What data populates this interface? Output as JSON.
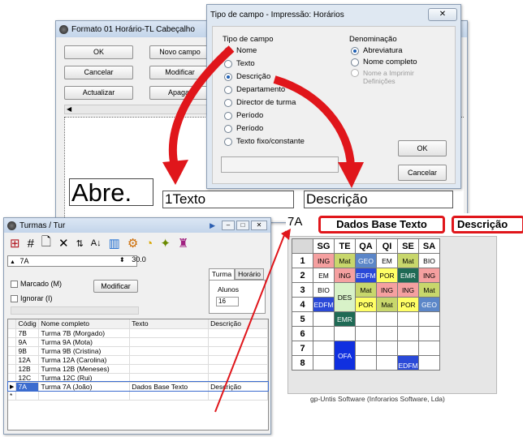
{
  "formato_window": {
    "title": "Formato 01  Horário-TL  Cabeçalho",
    "buttons": {
      "ok": "OK",
      "novo_campo": "Novo campo",
      "cancelar": "Cancelar",
      "modificar": "Modificar",
      "actualizar": "Actualizar",
      "apagar": "Apagar"
    },
    "canvas_fields": {
      "abreviatura": "Abre.",
      "texto": "1Texto",
      "descricao": "Descrição"
    }
  },
  "tipo_dialog": {
    "title": "Tipo de campo - Impressão: Horários",
    "tipo_group_label": "Tipo de campo",
    "tipo_options": [
      "Nome",
      "Texto",
      "Descrição",
      "Departamento",
      "Director de turma",
      "Período",
      "Período",
      "Texto fixo/constante"
    ],
    "denominacao_group_label": "Denominação",
    "denominacao_options": [
      "Abreviatura",
      "Nome completo",
      "Nome a Imprimir Definições"
    ],
    "ok_label": "OK",
    "cancel_label": "Cancelar"
  },
  "turmas_window": {
    "title": "Turmas / Tur",
    "current_class": "7A",
    "number_value": "30.0",
    "tabs": [
      "Turma",
      "Horário"
    ],
    "alunos_label": "Alunos",
    "alunos_value": "16",
    "marcado_label": "Marcado (M)",
    "ignorar_label": "Ignorar (I)",
    "modificar_label": "Modificar",
    "columns": [
      "Códig",
      "Nome completo",
      "Texto",
      "Descrição"
    ],
    "rows": [
      {
        "code": "7B",
        "name": "Turma 7B (Morgado)",
        "texto": "",
        "descricao": ""
      },
      {
        "code": "9A",
        "name": "Turma 9A (Mota)",
        "texto": "",
        "descricao": ""
      },
      {
        "code": "9B",
        "name": "Turma 9B (Cristina)",
        "texto": "",
        "descricao": ""
      },
      {
        "code": "12A",
        "name": "Turma 12A (Carolina)",
        "texto": "",
        "descricao": ""
      },
      {
        "code": "12B",
        "name": "Turma 12B (Meneses)",
        "texto": "",
        "descricao": ""
      },
      {
        "code": "12C",
        "name": "Turma 12C (Rui)",
        "texto": "",
        "descricao": ""
      },
      {
        "code": "7A",
        "name": "Turma 7A (João)",
        "texto": "Dados Base Texto",
        "descricao": "Descrição"
      }
    ],
    "new_row_marker": "*",
    "current_row_marker": "▶"
  },
  "timetable": {
    "class_label": "7A",
    "header_texto": "Dados Base Texto",
    "header_descricao": "Descrição",
    "days": [
      "SG",
      "TE",
      "QA",
      "QI",
      "SE",
      "SA"
    ],
    "periods": [
      "1",
      "2",
      "3",
      "4",
      "5",
      "6",
      "7",
      "8"
    ],
    "footer": "gp-Untis Software (Inforarios Software, Lda)",
    "colors": {
      "ING": "#f5a0a0",
      "Mat": "#c8d76c",
      "GEO": "#5b86c8",
      "EM": "#ffffff",
      "BIO": "#ffffff",
      "EDFM": "#2a49d8",
      "POR": "#ffff66",
      "EMR": "#1f6a55",
      "DES": "#d8f2c8",
      "OFA": "#1030e0",
      "highlight": "#e0161b"
    },
    "lessons": {
      "r1": [
        "ING",
        "Mat",
        "GEO",
        "EM",
        "Mat",
        "BIO"
      ],
      "r2": [
        "EM",
        "ING",
        "EDFM",
        "POR",
        "EMR",
        "ING"
      ],
      "r3": [
        "BIO",
        "DES",
        "Mat",
        "ING",
        "ING",
        "Mat"
      ],
      "r4": [
        "EDFM",
        "",
        "POR",
        "Mat",
        "POR",
        "GEO"
      ],
      "r5": [
        "",
        "EMR",
        "",
        "",
        "",
        ""
      ],
      "r7": [
        "",
        "OFA",
        "",
        "",
        "",
        ""
      ],
      "r8": [
        "",
        "",
        "",
        "",
        "EDFM",
        ""
      ]
    }
  }
}
